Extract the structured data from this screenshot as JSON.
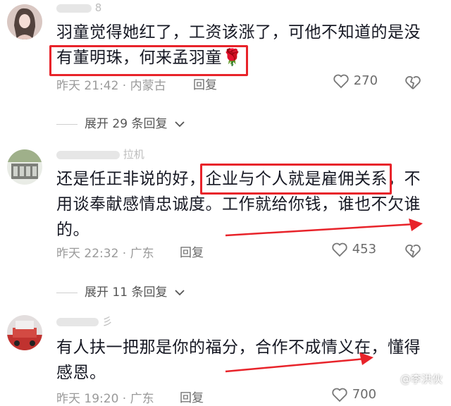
{
  "comments": [
    {
      "username": "8",
      "lines": [
        "羽童觉得她红了，工资该涨了，可他不知道的是没",
        "有董明珠，何来孟羽童🌹"
      ],
      "time": "昨天 21:42",
      "location": "内蒙古",
      "reply_label": "回复",
      "likes": "270",
      "expand_label": "展开 29 条回复"
    },
    {
      "username": "拉机",
      "lines": [
        "还是任正非说的好，企业与个人就是雇佣关系，不",
        "用谈奉献感情忠诚度。工作就给你钱，谁也不欠谁",
        "的。"
      ],
      "time": "昨天 22:32",
      "location": "广东",
      "reply_label": "回复",
      "likes": "453",
      "expand_label": "展开 11 条回复"
    },
    {
      "username": "彡",
      "lines": [
        "有人扶一把那是你的福分，合作不成情义在，懂得",
        "感恩。"
      ],
      "time": "昨天 19:20",
      "location": "广东",
      "reply_label": "回复",
      "likes": "700"
    }
  ],
  "watermark": "@李洪伙",
  "colors": {
    "highlight": "#e8232a",
    "text": "#161823",
    "meta": "#9a9a9a"
  }
}
